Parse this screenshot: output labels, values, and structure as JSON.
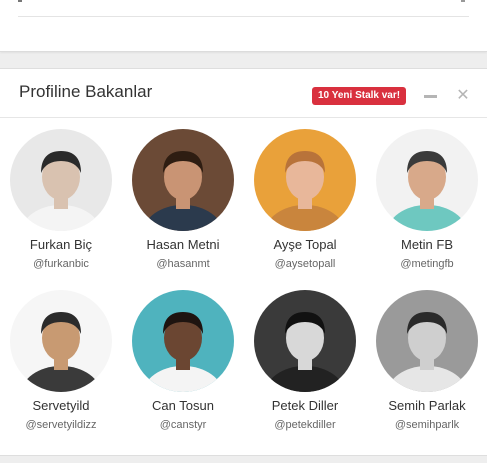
{
  "panel": {
    "title": "Profiline Bakanlar",
    "badge": "10 Yeni Stalk var!",
    "close_glyph": "✕"
  },
  "people": [
    {
      "name": "Furkan Biç",
      "handle": "@furkanbic",
      "bg": "#e8e8e8",
      "skin": "#d9c2b0",
      "hair": "#2a2a2a",
      "shirt": "#f4f4f4"
    },
    {
      "name": "Hasan Metni",
      "handle": "@hasanmt",
      "bg": "#6b4a36",
      "skin": "#c99474",
      "hair": "#2e1d12",
      "shirt": "#2b3a4d"
    },
    {
      "name": "Ayşe Topal",
      "handle": "@aysetopall",
      "bg": "#e9a13a",
      "skin": "#e8b79a",
      "hair": "#b8733a",
      "shirt": "#c9853d"
    },
    {
      "name": "Metin FB",
      "handle": "@metingfb",
      "bg": "#f2f2f2",
      "skin": "#d8a98a",
      "hair": "#3a3a3a",
      "shirt": "#6ec8c0"
    },
    {
      "name": "Servetyild",
      "handle": "@servetyildizz",
      "bg": "#f6f6f6",
      "skin": "#c89a72",
      "hair": "#2b2b2b",
      "shirt": "#3a3a3a"
    },
    {
      "name": "Can Tosun",
      "handle": "@canstyr",
      "bg": "#4fb3be",
      "skin": "#6b4632",
      "hair": "#1e1410",
      "shirt": "#f4f4f4"
    },
    {
      "name": "Petek Diller",
      "handle": "@petekdiller",
      "bg": "#3a3a3a",
      "skin": "#d8d8d8",
      "hair": "#111111",
      "shirt": "#222222"
    },
    {
      "name": "Semih Parlak",
      "handle": "@semihparlk",
      "bg": "#9a9a9a",
      "skin": "#cfcfcf",
      "hair": "#2a2a2a",
      "shirt": "#e6e6e6"
    }
  ]
}
